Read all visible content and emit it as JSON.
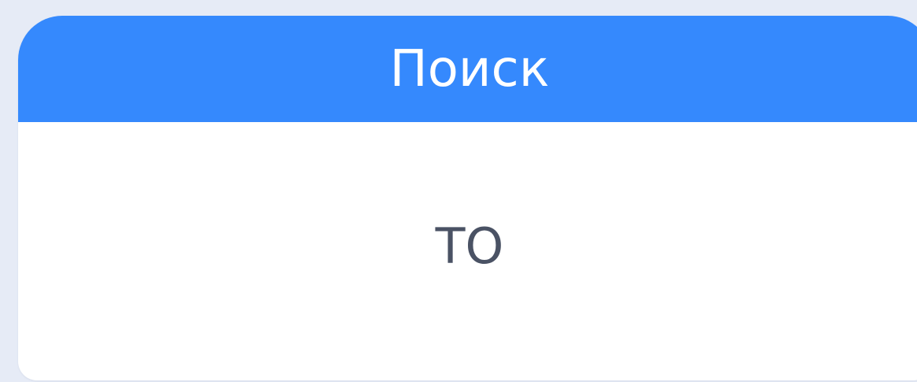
{
  "card": {
    "title": "Поиск",
    "value": "ТО"
  },
  "colors": {
    "background": "#e6ebf6",
    "header": "#3589fd",
    "card": "#ffffff",
    "value_text": "#4a5264"
  }
}
